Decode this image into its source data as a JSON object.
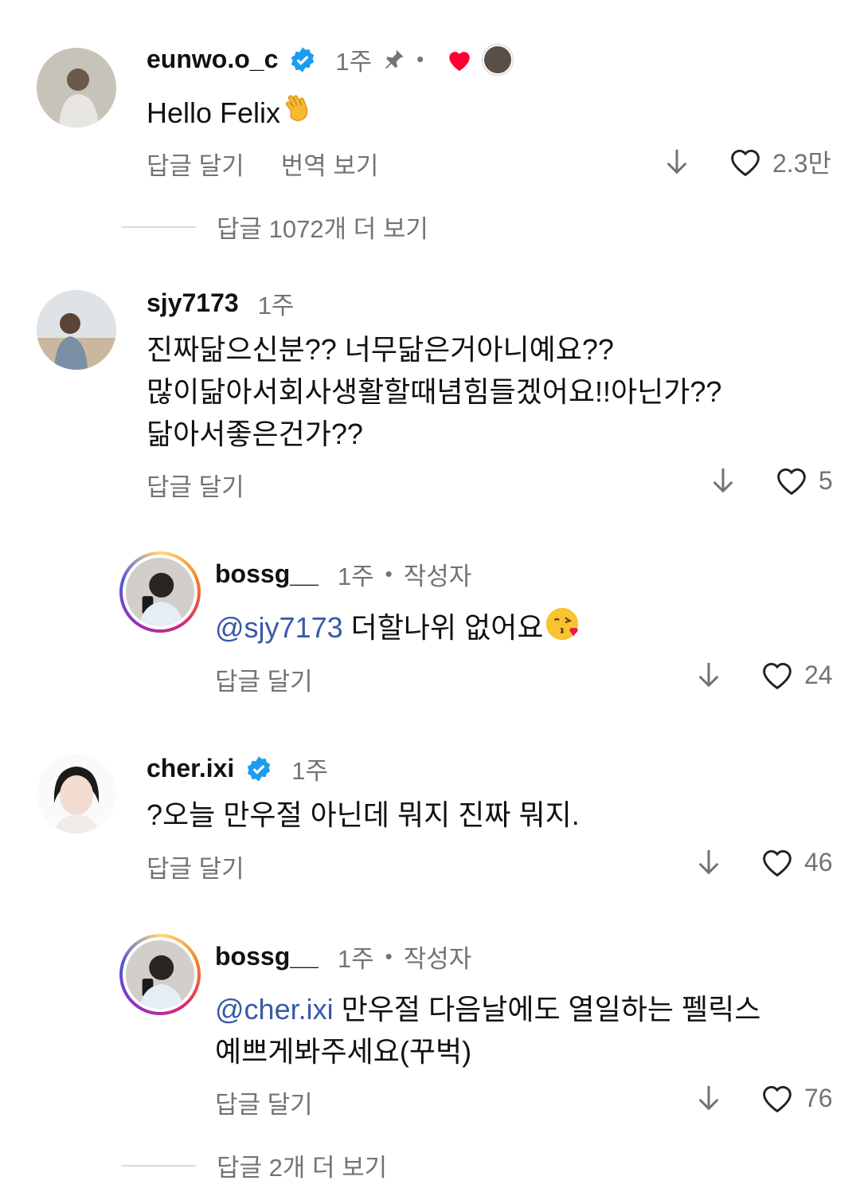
{
  "comments": [
    {
      "username": "eunwo.o_c",
      "time": "1주",
      "text": "Hello Felix",
      "reply_label": "답글 달기",
      "translate_label": "번역 보기",
      "likes": "2.3만"
    },
    {
      "username": "sjy7173",
      "time": "1주",
      "text_lines": [
        "진짜닮으신분?? 너무닮은거아니예요??",
        "많이닮아서회사생활할때념힘들겠어요!!아닌가??",
        "닮아서좋은건가??"
      ],
      "reply_label": "답글 달기",
      "likes": "5"
    },
    {
      "username": "bossg__",
      "time": "1주",
      "author_label": "작성자",
      "mention": "@sjy7173",
      "text": " 더할나위 없어요",
      "reply_label": "답글 달기",
      "likes": "24"
    },
    {
      "username": "cher.ixi",
      "time": "1주",
      "text": "?오늘 만우절 아닌데 뭐지 진짜 뭐지.",
      "reply_label": "답글 달기",
      "likes": "46"
    },
    {
      "username": "bossg__",
      "time": "1주",
      "author_label": "작성자",
      "mention": "@cher.ixi",
      "text": " 만우절 다음날에도 열일하는 펠릭스",
      "text_line2": "예쁘게봐주세요(꾸벅)",
      "reply_label": "답글 달기",
      "likes": "76"
    }
  ],
  "more_replies": [
    "답글 1072개 더 보기",
    "답글 2개 더 보기"
  ],
  "colors": {
    "verified": "#1d9bf0",
    "mention": "#3759a8",
    "liked": "#ff0033",
    "muted": "#737373"
  }
}
